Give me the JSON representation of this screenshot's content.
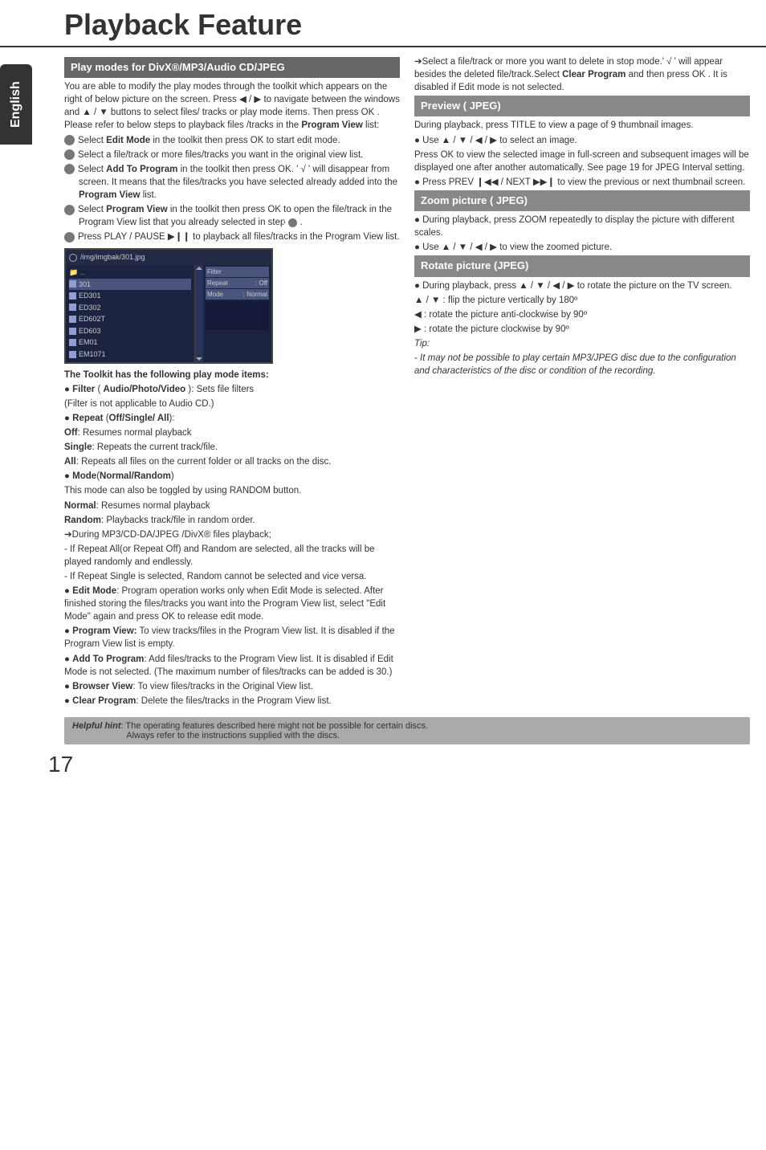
{
  "page": {
    "title": "Playback Feature",
    "sidebar_lang": "English",
    "page_number": "17"
  },
  "left": {
    "sec1_header": "Play modes for DivX®/MP3/Audio CD/JPEG",
    "intro1": "You are able to modify the play modes through the toolkit which appears on the right of below picture on the screen. Press ◀ / ▶ to navigate between the windows and ▲ / ▼ buttons to select files/ tracks or play mode items. Then press OK . Please refer to below steps to playback files /tracks in the ",
    "intro1_bold": "Program View",
    "intro1_end": " list:",
    "step1a": "Select ",
    "step1b": "Edit Mode",
    "step1c": " in the toolkit then press OK to start edit mode.",
    "step2": "Select a file/track or more files/tracks you want in the original view list.",
    "step3a": "Select  ",
    "step3b": "Add To Program",
    "step3c": " in the toolkit then press OK. ' √ ' will disappear from screen. It means that the files/tracks you have selected already added into the ",
    "step3d": "Program View",
    "step3e": " list.",
    "step4a": "Select  ",
    "step4b": "Program View",
    "step4c": " in the toolkit then press OK to open the file/track in the Program View list  that you already selected in step ",
    "step4d": ".",
    "step5a": "Press PLAY / PAUSE ",
    "step5b": " to playback all files/tracks in the Program View list.",
    "shot": {
      "path": "/img/imgbak/301.jpg",
      "rows": [
        "..",
        "301",
        "ED301",
        "ED302",
        "ED602T",
        "ED603",
        "EM01",
        "EM1071"
      ],
      "opt_filter": "Filter",
      "opt_repeat_l": "Repeat",
      "opt_repeat_r": ": Off",
      "opt_mode_l": "Mode",
      "opt_mode_r": ": Normal"
    },
    "toolkit_heading": "The Toolkit has the following play mode items:",
    "filter_line_a": "● ",
    "filter_line_b": "Filter",
    "filter_line_c": " ( ",
    "filter_line_d": "Audio/Photo/Video",
    "filter_line_e": " ): Sets file filters",
    "filter_note": "(Filter is not applicable to Audio CD.)",
    "repeat_a": "● ",
    "repeat_b": "Repeat",
    "repeat_c": " (",
    "repeat_d": "Off/Single/ All",
    "repeat_e": "):",
    "off_l": "Off",
    "off_r": ":      Resumes normal playback",
    "single_l": "Single",
    "single_r": ": Repeats the current track/file.",
    "all_l": "All",
    "all_r": ":       Repeats all files on the current folder or all tracks on the disc.",
    "mode_a": "● ",
    "mode_b": "Mode",
    "mode_c": "(",
    "mode_d": "Normal/Random",
    "mode_e": ")",
    "mode_note": "This mode can also be toggled by using RANDOM button.",
    "normal_l": "Normal",
    "normal_r": ": Resumes normal playback",
    "random_l": "Random",
    "random_r": ": Playbacks track/file in random order.",
    "during1": "➔During MP3/CD-DA/JPEG /DivX® files playback;",
    "during2": "- If Repeat All(or Repeat Off) and Random are selected, all the tracks will be played randomly and endlessly.",
    "during3": "- If Repeat Single is selected, Random cannot be selected and vice versa.",
    "editmode_a": "● ",
    "editmode_b": "Edit Mode",
    "editmode_c": ": Program operation  works only when Edit Mode is selected. After finished storing the files/tracks you want into the Program View list, select \"Edit Mode\" again and press OK to release edit mode.",
    "progview_a": "● ",
    "progview_b": "Program View:",
    "progview_c": "  To view tracks/files in the Program View list. It is disabled if the Program View list is empty.",
    "addto_a": "● ",
    "addto_b": "Add To Program",
    "addto_c": ": Add files/tracks to the Program View list. It is disabled if Edit Mode is not selected. (The maximum number of files/tracks can be added is 30.)",
    "browser_a": "● ",
    "browser_b": "Browser View",
    "browser_c": ": To view files/tracks in the Original View list.",
    "clear_a": "● ",
    "clear_b": "Clear Program",
    "clear_c": ": Delete the files/tracks in the Program View list."
  },
  "right": {
    "top1": "➔Select a file/track or more you want to delete in stop mode.' √ ' will appear besides the deleted file/track.Select ",
    "top1b": "Clear Program",
    "top1c": " and then press OK . It is disabled if Edit mode is not selected.",
    "sec_preview": "Preview ( JPEG)",
    "preview1": "During playback, press TITLE to view a page of 9 thumbnail images.",
    "preview2": "● Use ▲ / ▼ / ◀ / ▶ to select an image.",
    "preview3": "Press OK to view the selected image in full-screen and subsequent images will be displayed one after another automatically. See page 19 for JPEG Interval setting.",
    "preview4a": "● Press PREV ",
    "preview4b": " / NEXT ",
    "preview4c": " to view the previous or next thumbnail screen.",
    "sec_zoom": "Zoom picture ( JPEG)",
    "zoom1": "● During playback, press ZOOM repeatedly to display the picture with different scales.",
    "zoom2": "● Use ▲ / ▼ / ◀ / ▶ to view the zoomed picture.",
    "sec_rotate": "Rotate picture (JPEG)",
    "rotate1": "● During playback, press ▲ / ▼ / ◀ / ▶ to rotate the picture on the TV screen.",
    "rotate2": "▲ / ▼ :  flip the picture vertically by 180º",
    "rotate3": "◀ :  rotate the picture anti-clockwise by 90º",
    "rotate4": "▶ :  rotate the picture clockwise by 90º",
    "tip_label": "Tip:",
    "tip_body": "- It may not be possible to play certain MP3/JPEG disc due to the configuration and characteristics of the disc or condition of the recording."
  },
  "hint": {
    "label": "Helpful hint",
    "sep": ": ",
    "l1": "The operating features described here might not be possible for certain discs.",
    "l2": "Always refer to the instructions  supplied with the discs."
  }
}
